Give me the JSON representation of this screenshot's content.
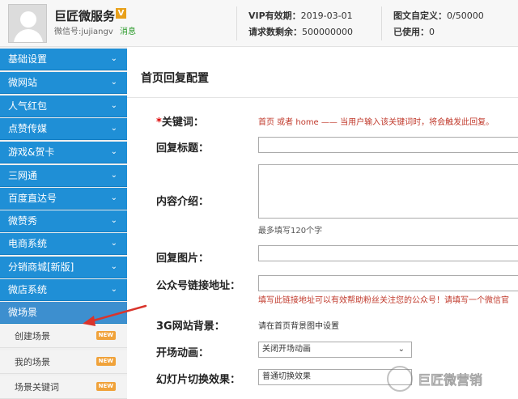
{
  "account": {
    "name": "巨匠微服务",
    "v_badge": "V",
    "wechat_id": "微信号:jujiangv",
    "message_link": "消息"
  },
  "stats": {
    "vip_expiry_label": "VIP有效期：",
    "vip_expiry_value": "2019-03-01",
    "requests_left_label": "请求数剩余：",
    "requests_left_value": "500000000",
    "custom_text_label": "图文自定义：",
    "custom_text_value": "0/50000",
    "used_label": "已使用：",
    "used_value": "0"
  },
  "sidebar": {
    "items": [
      {
        "label": "基础设置"
      },
      {
        "label": "微网站"
      },
      {
        "label": "人气红包"
      },
      {
        "label": "点赞传媒"
      },
      {
        "label": "游戏&贺卡"
      },
      {
        "label": "三网通"
      },
      {
        "label": "百度直达号"
      },
      {
        "label": "微赞秀"
      },
      {
        "label": "电商系统"
      },
      {
        "label": "分销商城[新版]"
      },
      {
        "label": "微店系统"
      },
      {
        "label": "微场景"
      }
    ],
    "sub_items": [
      {
        "label": "创建场景",
        "badge": "NEW"
      },
      {
        "label": "我的场景",
        "badge": "NEW"
      },
      {
        "label": "场景关键词",
        "badge": "NEW"
      }
    ]
  },
  "main": {
    "title": "首页回复配置",
    "form": {
      "keyword_required_mark": "*",
      "keyword_label": "关键词：",
      "keyword_hint": "首页 或者 home —— 当用户输入该关键词时，将会触发此回复。",
      "reply_title_label": "回复标题：",
      "description_label": "内容介绍：",
      "description_hint": "最多填写120个字",
      "reply_image_label": "回复图片：",
      "account_link_label": "公众号链接地址：",
      "account_link_hint": "填写此链接地址可以有效帮助粉丝关注您的公众号！请填写一个微信官",
      "bg_label": "3G网站背景：",
      "bg_value": "请在首页背景图中设置",
      "opening_anim_label": "开场动画：",
      "opening_anim_value": "关闭开场动画",
      "slide_effect_label": "幻灯片切换效果：",
      "slide_effect_value": "普通切换效果"
    }
  },
  "watermark": {
    "text": "巨匠微营销"
  },
  "colors": {
    "menu_blue": "#1f8fd6",
    "hint_red": "#c0392b",
    "arrow_red": "#d9342b"
  }
}
